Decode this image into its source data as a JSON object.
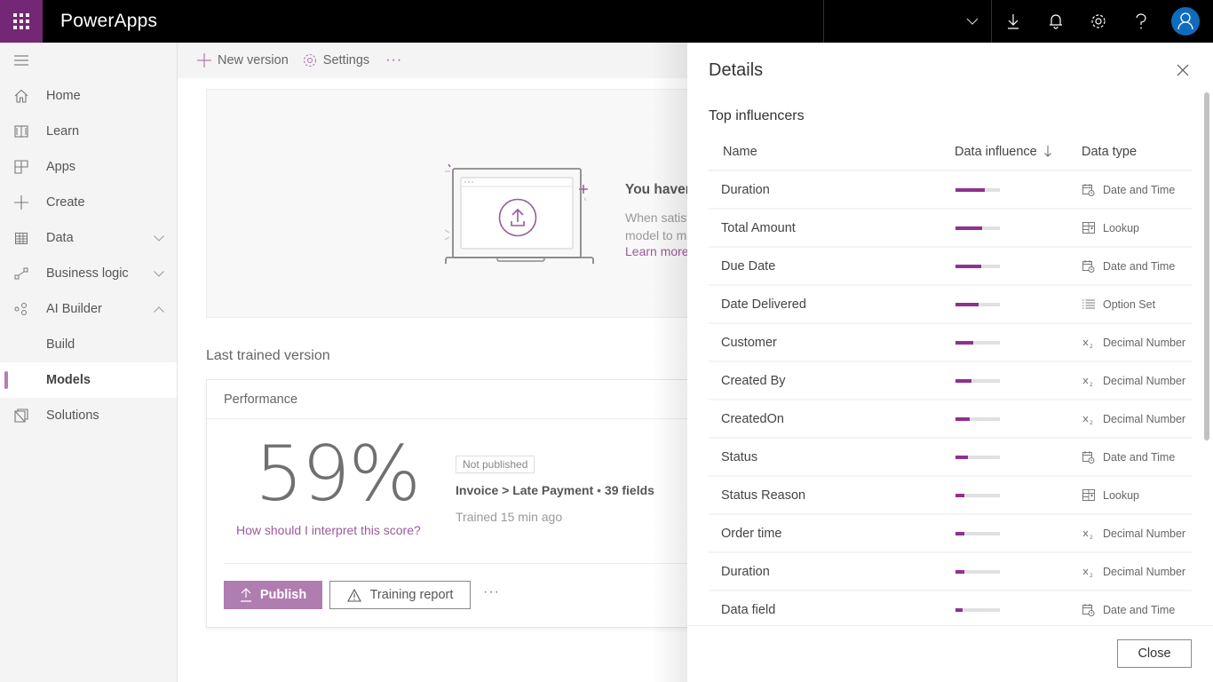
{
  "topbar": {
    "app_title": "PowerApps",
    "icons": [
      "waffle-icon",
      "chevron-down-icon",
      "download-icon",
      "bell-icon",
      "gear-icon",
      "help-icon",
      "avatar-icon"
    ]
  },
  "sidebar": {
    "items": [
      {
        "label": "Home",
        "icon": "home-icon"
      },
      {
        "label": "Learn",
        "icon": "book-icon"
      },
      {
        "label": "Apps",
        "icon": "apps-icon"
      },
      {
        "label": "Create",
        "icon": "plus-icon"
      },
      {
        "label": "Data",
        "icon": "table-icon",
        "expand": "down"
      },
      {
        "label": "Business logic",
        "icon": "flow-icon",
        "expand": "down"
      },
      {
        "label": "AI Builder",
        "icon": "ai-builder-icon",
        "expand": "up"
      },
      {
        "label": "Build",
        "sub": true
      },
      {
        "label": "Models",
        "sub": true,
        "active": true
      },
      {
        "label": "Solutions",
        "icon": "solutions-icon"
      }
    ]
  },
  "commandbar": {
    "new_version": "New version",
    "settings": "Settings",
    "more": "···"
  },
  "empty_state": {
    "title": "You haven't published this model yet",
    "desc_line1": "When satisfied with the performance, publish your",
    "desc_line2": "model to make it available.",
    "link": "Learn more"
  },
  "last_trained": {
    "section_title": "Last trained version",
    "card_title": "Performance",
    "score": "59%",
    "score_value_percent": 59,
    "score_link": "How should I interpret this score?",
    "status": "Not published",
    "model_path": "Invoice > Late Payment",
    "field_count": "39 fields",
    "separator": "•",
    "trained": "Trained 15 min ago",
    "publish": "Publish",
    "training_report": "Training report",
    "more": "···"
  },
  "details": {
    "title": "Details",
    "subtitle": "Top influencers",
    "columns": {
      "name": "Name",
      "influence": "Data influence",
      "type": "Data type",
      "sort_icon": "arrow-down-icon"
    },
    "rows": [
      {
        "name": "Duration",
        "influence": 0.66,
        "type": "Date and Time",
        "icon": "calendar-clock-icon"
      },
      {
        "name": "Total Amount",
        "influence": 0.6,
        "type": "Lookup",
        "icon": "lookup-icon"
      },
      {
        "name": "Due Date",
        "influence": 0.58,
        "type": "Date and Time",
        "icon": "calendar-clock-icon"
      },
      {
        "name": "Date Delivered",
        "influence": 0.52,
        "type": "Option Set",
        "icon": "list-icon"
      },
      {
        "name": "Customer",
        "influence": 0.4,
        "type": "Decimal Number",
        "icon": "decimal-icon"
      },
      {
        "name": "Created By",
        "influence": 0.36,
        "type": "Decimal Number",
        "icon": "decimal-icon"
      },
      {
        "name": "CreatedOn",
        "influence": 0.32,
        "type": "Decimal Number",
        "icon": "decimal-icon"
      },
      {
        "name": "Status",
        "influence": 0.28,
        "type": "Date and Time",
        "icon": "calendar-clock-icon"
      },
      {
        "name": "Status Reason",
        "influence": 0.2,
        "type": "Lookup",
        "icon": "lookup-icon"
      },
      {
        "name": "Order time",
        "influence": 0.2,
        "type": "Decimal Number",
        "icon": "decimal-icon"
      },
      {
        "name": "Duration",
        "influence": 0.2,
        "type": "Decimal Number",
        "icon": "decimal-icon"
      },
      {
        "name": "Data field",
        "influence": 0.16,
        "type": "Date and Time",
        "icon": "calendar-clock-icon"
      }
    ],
    "close_button": "Close"
  },
  "colors": {
    "brand": "#742774",
    "accent": "#b07db0",
    "influence_bar": "#8e3190",
    "link": "#9a5a9a",
    "avatar": "#0f6cbd"
  }
}
